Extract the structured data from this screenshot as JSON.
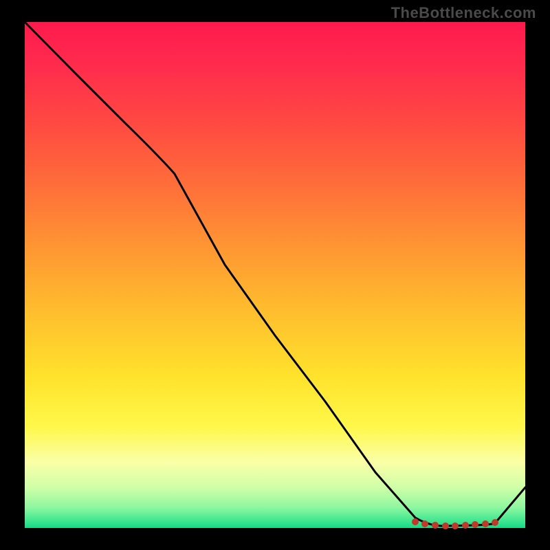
{
  "watermark": "TheBottleneck.com",
  "chart_data": {
    "type": "line",
    "title": "",
    "xlabel": "",
    "ylabel": "",
    "x": [
      0.0,
      0.1,
      0.2,
      0.3,
      0.4,
      0.5,
      0.6,
      0.7,
      0.78,
      0.84,
      0.9,
      0.94,
      1.0
    ],
    "y": [
      1.0,
      0.9,
      0.8,
      0.7,
      0.52,
      0.38,
      0.25,
      0.11,
      0.02,
      0.0,
      0.0,
      0.0,
      0.08
    ],
    "ylim": [
      0,
      1
    ],
    "xlim": [
      0,
      1
    ],
    "markers": {
      "x": [
        0.78,
        0.8,
        0.82,
        0.84,
        0.86,
        0.88,
        0.9,
        0.92,
        0.94
      ],
      "y": [
        0.012,
        0.008,
        0.005,
        0.004,
        0.004,
        0.005,
        0.006,
        0.007,
        0.01
      ]
    },
    "gradient_stops": [
      {
        "pos": 0.0,
        "color": "#ff1a4d"
      },
      {
        "pos": 0.5,
        "color": "#ffba2e"
      },
      {
        "pos": 0.8,
        "color": "#fff84a"
      },
      {
        "pos": 1.0,
        "color": "#16d882"
      }
    ]
  }
}
